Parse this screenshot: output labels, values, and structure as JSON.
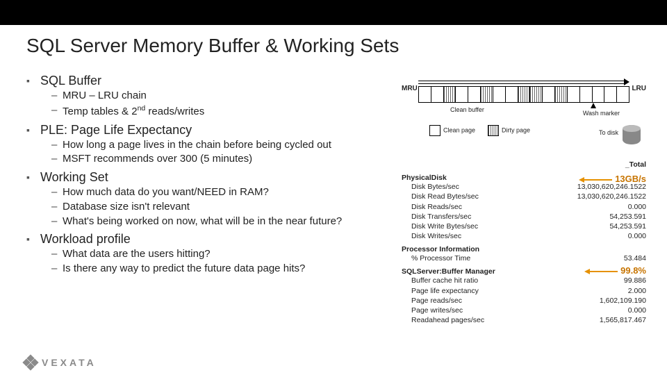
{
  "title": "SQL Server Memory Buffer & Working Sets",
  "bullets": {
    "b1": "SQL Buffer",
    "b1s1": "MRU – LRU chain",
    "b1s2_pre": "Temp tables & 2",
    "b1s2_sup": "nd",
    "b1s2_post": " reads/writes",
    "b2": "PLE:  Page Life Expectancy",
    "b2s1": "How long a page lives in the chain before being cycled out",
    "b2s2": "MSFT recommends over 300 (5 minutes)",
    "b3": "Working Set",
    "b3s1": "How much data do you want/NEED in RAM?",
    "b3s2": "Database size isn't relevant",
    "b3s3": "What's being worked on now, what will be in the near future?",
    "b4": "Workload profile",
    "b4s1": "What data are the users hitting?",
    "b4s2": "Is there any way to predict the future data page hits?"
  },
  "diagram": {
    "mru": "MRU",
    "lru": "LRU",
    "clean_buffer": "Clean buffer",
    "wash_marker": "Wash marker",
    "legend_clean": "Clean page",
    "legend_dirty": "Dirty page",
    "to_disk": "To disk"
  },
  "callouts": {
    "throughput": "13GB/s",
    "hitratio": "99.8%"
  },
  "perf": {
    "total_col": "_Total",
    "g1": "PhysicalDisk",
    "g1r": [
      {
        "k": "Disk Bytes/sec",
        "v": "13,030,620,246.1522"
      },
      {
        "k": "Disk Read Bytes/sec",
        "v": "13,030,620,246.1522"
      },
      {
        "k": "Disk Reads/sec",
        "v": "0.000"
      },
      {
        "k": "Disk Transfers/sec",
        "v": "54,253.591"
      },
      {
        "k": "Disk Write Bytes/sec",
        "v": "54,253.591"
      },
      {
        "k": "Disk Writes/sec",
        "v": "0.000"
      }
    ],
    "g2": "Processor Information",
    "g2r": [
      {
        "k": "% Processor Time",
        "v": "53.484"
      }
    ],
    "g3": "SQLServer:Buffer Manager",
    "g3r": [
      {
        "k": "Buffer cache hit ratio",
        "v": "99.886"
      },
      {
        "k": "Page life expectancy",
        "v": "2.000"
      },
      {
        "k": "Page reads/sec",
        "v": "1,602,109.190"
      },
      {
        "k": "Page writes/sec",
        "v": "0.000"
      },
      {
        "k": "Readahead pages/sec",
        "v": "1,565,817.467"
      }
    ]
  },
  "logo": "VEXATA"
}
